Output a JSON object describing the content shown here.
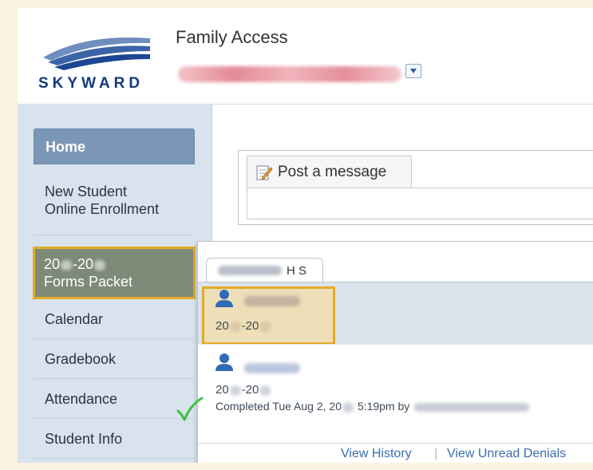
{
  "header": {
    "logo_text": "SKYWARD",
    "app_title": "Family Access"
  },
  "sidebar": {
    "items": [
      {
        "label": "Home"
      },
      {
        "label": "New Student Online Enrollment"
      },
      {
        "label_start": "20",
        "label_mid": "-20",
        "label_rest": "Forms Packet"
      },
      {
        "label": "Calendar"
      },
      {
        "label": "Gradebook"
      },
      {
        "label": "Attendance"
      },
      {
        "label": "Student Info"
      }
    ]
  },
  "message": {
    "tab_label": "Post a message"
  },
  "popup": {
    "school_tab": "H S",
    "students": [
      {
        "year_a": "20",
        "year_b": "-20"
      },
      {
        "year_a": "20",
        "year_b": "-20",
        "completed_prefix": "Completed Tue Aug 2, 20",
        "completed_suffix": "5:19pm by"
      }
    ],
    "footer": {
      "view_history": "View History",
      "separator": "|",
      "view_unread_denials": "View Unread Denials"
    }
  },
  "colors": {
    "highlight_border": "#e3aa25",
    "home_tab": "#7b97b7",
    "link": "#3a6fb0",
    "checkmark": "#3cc23c"
  }
}
